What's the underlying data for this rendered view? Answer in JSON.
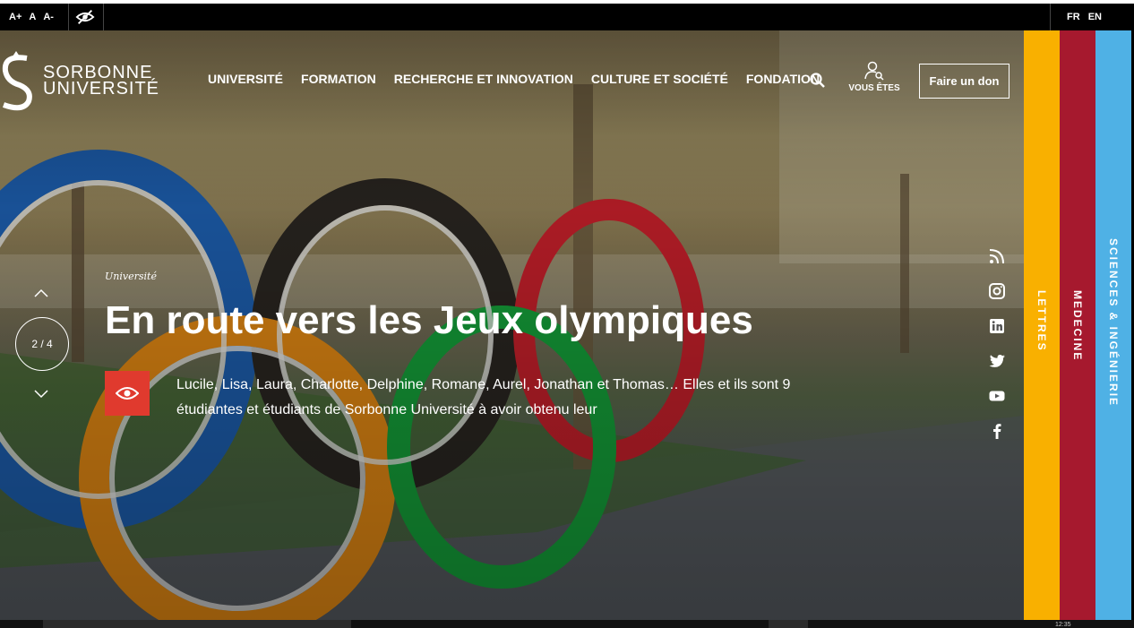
{
  "topbar": {
    "font_sizes": [
      "A+",
      "A",
      "A-"
    ],
    "languages": [
      "FR",
      "EN"
    ]
  },
  "logo": {
    "line1": "SORBONNE",
    "line2": "UNIVERSITÉ"
  },
  "nav": {
    "items": [
      "UNIVERSITÉ",
      "FORMATION",
      "RECHERCHE ET INNOVATION",
      "CULTURE ET SOCIÉTÉ",
      "FONDATION"
    ],
    "user_label": "VOUS ÊTES",
    "donate_label": "Faire un don"
  },
  "hero": {
    "category": "Université",
    "title": "En route vers les Jeux olympiques",
    "description": "Lucile, Lisa, Laura, Charlotte, Delphine, Romane, Aurel, Jonathan et Thomas… Elles et ils sont 9 étudiantes et étudiants de Sorbonne Université à avoir obtenu leur",
    "slide_counter": "2 / 4"
  },
  "social": [
    "rss-icon",
    "instagram-icon",
    "linkedin-icon",
    "twitter-icon",
    "youtube-icon",
    "facebook-icon"
  ],
  "side_tabs": [
    {
      "label": "LETTRES",
      "color": "#f9b000"
    },
    {
      "label": "MEDECINE",
      "color": "#a6192e"
    },
    {
      "label": "SCIENCES & INGÉNIERIE",
      "color": "#4fb1e5"
    }
  ],
  "colors": {
    "accent_red": "#e03a2e"
  },
  "taskbar": {
    "clock": "12:35"
  }
}
